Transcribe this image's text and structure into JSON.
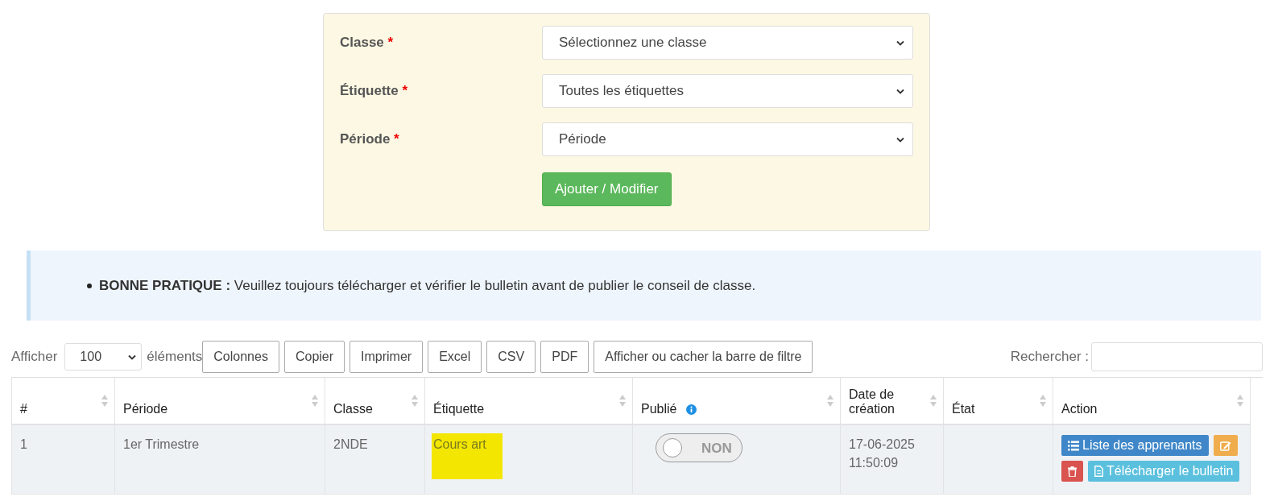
{
  "form": {
    "fields": [
      {
        "label": "Classe",
        "required_mark": "*",
        "value": "Sélectionnez une classe"
      },
      {
        "label": "Étiquette",
        "required_mark": "*",
        "value": "Toutes les étiquettes"
      },
      {
        "label": "Période",
        "required_mark": "*",
        "value": "Période"
      }
    ],
    "submit": "Ajouter / Modifier"
  },
  "notice": {
    "items": [
      "**BONNE PRATIQUE :** Veuillez toujours télécharger et vérifier le bulletin avant de publier le conseil de classe."
    ]
  },
  "toolbar": {
    "show_label": "Afficher",
    "page_size": "100",
    "items_label": "éléments",
    "buttons": [
      "Colonnes",
      "Copier",
      "Imprimer",
      "Excel",
      "CSV",
      "PDF",
      "Afficher ou cacher la barre de filtre"
    ],
    "search_label": "Rechercher :"
  },
  "table": {
    "columns": [
      {
        "label": "#",
        "info": false
      },
      {
        "label": "Période",
        "info": false
      },
      {
        "label": "Classe",
        "info": false
      },
      {
        "label": "Étiquette",
        "info": false
      },
      {
        "label": "Publié",
        "info": true
      },
      {
        "label": "Date de création",
        "info": false
      },
      {
        "label": "État",
        "info": false
      },
      {
        "label": "Action",
        "info": false
      }
    ],
    "rows": [
      {
        "number": "1",
        "period": "1er Trimestre",
        "class": "2NDE",
        "label": "Cours art",
        "label_highlighted": true,
        "published": {
          "on": false,
          "text": "NON"
        },
        "created": [
          "17-06-2025",
          "11:50:09"
        ],
        "actions": [
          {
            "kind": "list",
            "label": "Liste des apprenants"
          },
          {
            "kind": "edit"
          },
          {
            "kind": "delete"
          },
          {
            "kind": "download",
            "label": "Télécharger le bulletin"
          }
        ]
      }
    ]
  }
}
